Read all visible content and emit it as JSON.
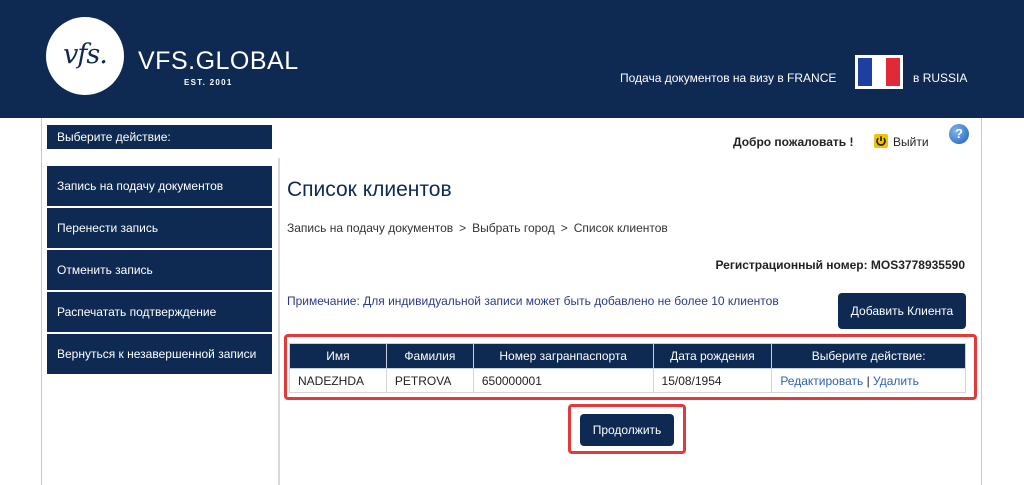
{
  "header": {
    "logo_text": "vfs.",
    "brand": "VFS.GLOBAL",
    "established": "EST. 2001",
    "visa_text": "Подача документов на визу в FRANCE",
    "country_text": "в RUSSIA",
    "flag_colors": [
      "#1f3fa0",
      "#ffffff",
      "#e12a38"
    ]
  },
  "sidebar": {
    "title": "Выберите действие:",
    "items": [
      {
        "label": "Запись на подачу документов"
      },
      {
        "label": "Перенести запись"
      },
      {
        "label": "Отменить запись"
      },
      {
        "label": "Распечатать подтверждение"
      },
      {
        "label": "Вернуться к незавершенной записи"
      }
    ]
  },
  "topbar": {
    "welcome": "Добро пожаловать !",
    "logout": "Выйти",
    "help": "?"
  },
  "main": {
    "title": "Список клиентов",
    "breadcrumb": [
      "Запись на подачу документов",
      "Выбрать город",
      "Список клиентов"
    ],
    "breadcrumb_separator": ">",
    "registration": "Регистрационный номер: MOS3778935590",
    "note": "Примечание: Для индивидуальной записи может быть добавлено не более 10 клиентов",
    "add_button": "Добавить Клиента",
    "table": {
      "headers": [
        "Имя",
        "Фамилия",
        "Номер загранпаспорта",
        "Дата рождения",
        "Выберите действие:"
      ],
      "rows": [
        {
          "first_name": "NADEZHDA",
          "last_name": "PETROVA",
          "passport": "650000001",
          "birth_date": "15/08/1954",
          "edit": "Редактировать",
          "divider": "|",
          "delete": "Удалить"
        }
      ]
    },
    "continue_button": "Продолжить"
  },
  "colors": {
    "brand_navy": "#0e2a52",
    "highlight_red": "#e23a3a",
    "link_blue": "#2f5fb5"
  }
}
